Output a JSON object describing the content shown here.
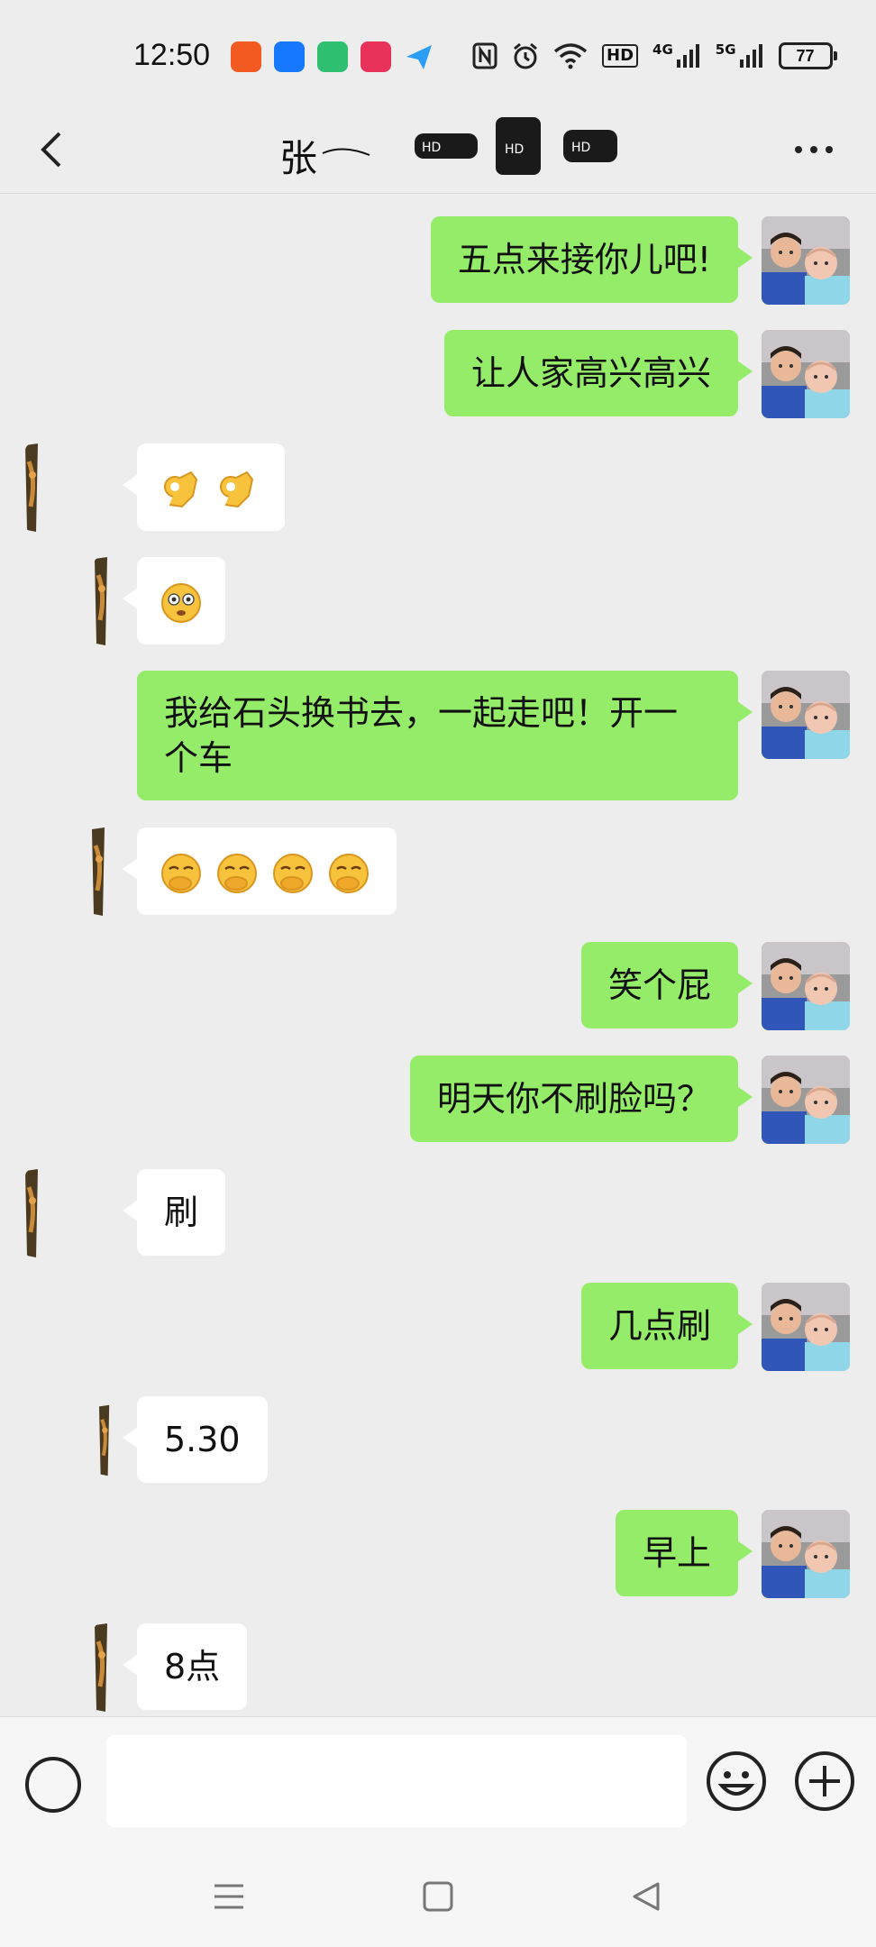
{
  "status_bar": {
    "time": "12:50",
    "app_icons": [
      {
        "name": "kuaishou-app-icon",
        "color": "#f25a22"
      },
      {
        "name": "alipay-app-icon",
        "color": "#1677ff"
      },
      {
        "name": "chat-app-icon",
        "color": "#2fbf71"
      },
      {
        "name": "video-app-icon",
        "color": "#e8325a"
      },
      {
        "name": "paper-plane-app-icon",
        "color": "#2a9df4"
      }
    ],
    "indicators": [
      "nfc-icon",
      "alarm-icon",
      "wifi-icon",
      "hd-volte-icon",
      "signal-4g-icon",
      "signal-5g-icon"
    ],
    "hd_label": "HD",
    "net1": "4G",
    "net2": "5G",
    "battery": "77"
  },
  "header": {
    "title": "张"
  },
  "messages": [
    {
      "side": "out",
      "text": "五点来接你儿吧!"
    },
    {
      "side": "out",
      "text": "让人家高兴高兴"
    },
    {
      "side": "in",
      "text": "",
      "emoji": [
        "ok-hand-emoji",
        "ok-hand-emoji"
      ]
    },
    {
      "side": "in",
      "text": "",
      "emoji": [
        "flushed-face-emoji"
      ]
    },
    {
      "side": "out",
      "text": "我给石头换书去，一起走吧！开一个车"
    },
    {
      "side": "in",
      "text": "",
      "emoji": [
        "laughing-cover-mouth-emoji",
        "laughing-cover-mouth-emoji",
        "laughing-cover-mouth-emoji",
        "laughing-cover-mouth-emoji"
      ]
    },
    {
      "side": "out",
      "text": "笑个屁"
    },
    {
      "side": "out",
      "text": "明天你不刷脸吗？"
    },
    {
      "side": "in",
      "text": "刷"
    },
    {
      "side": "out",
      "text": "几点刷"
    },
    {
      "side": "in",
      "text": "5.30"
    },
    {
      "side": "out",
      "text": "早上"
    },
    {
      "side": "in",
      "text": "8点"
    }
  ],
  "input_bar": {
    "placeholder": ""
  },
  "colors": {
    "outgoing_bubble": "#95ec69",
    "incoming_bubble": "#ffffff",
    "chat_background": "#ededed"
  }
}
